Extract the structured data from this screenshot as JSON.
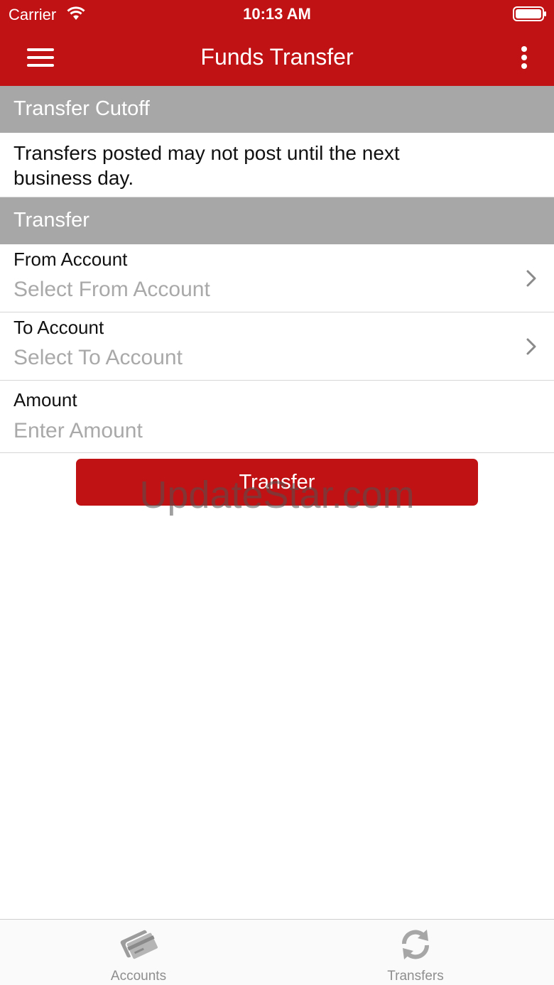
{
  "status_bar": {
    "carrier": "Carrier",
    "time": "10:13 AM"
  },
  "nav": {
    "title": "Funds Transfer",
    "menu_icon": "hamburger-menu-icon",
    "more_icon": "more-vertical-icon"
  },
  "cutoff": {
    "header": "Transfer Cutoff",
    "message": "Transfers posted may not post until the next business day."
  },
  "transfer_form": {
    "header": "Transfer",
    "from_account": {
      "label": "From Account",
      "placeholder": "Select From Account"
    },
    "to_account": {
      "label": "To Account",
      "placeholder": "Select To Account"
    },
    "amount": {
      "label": "Amount",
      "placeholder": "Enter Amount"
    },
    "submit_label": "Transfer"
  },
  "watermark": "UpdateStar.com",
  "tabbar": {
    "tabs": [
      {
        "label": "Accounts",
        "icon": "credit-card-icon"
      },
      {
        "label": "Transfers",
        "icon": "refresh-arrows-icon"
      }
    ]
  },
  "colors": {
    "brand": "#c01214",
    "section_header": "#a7a7a7",
    "placeholder": "#a9a9a9"
  }
}
